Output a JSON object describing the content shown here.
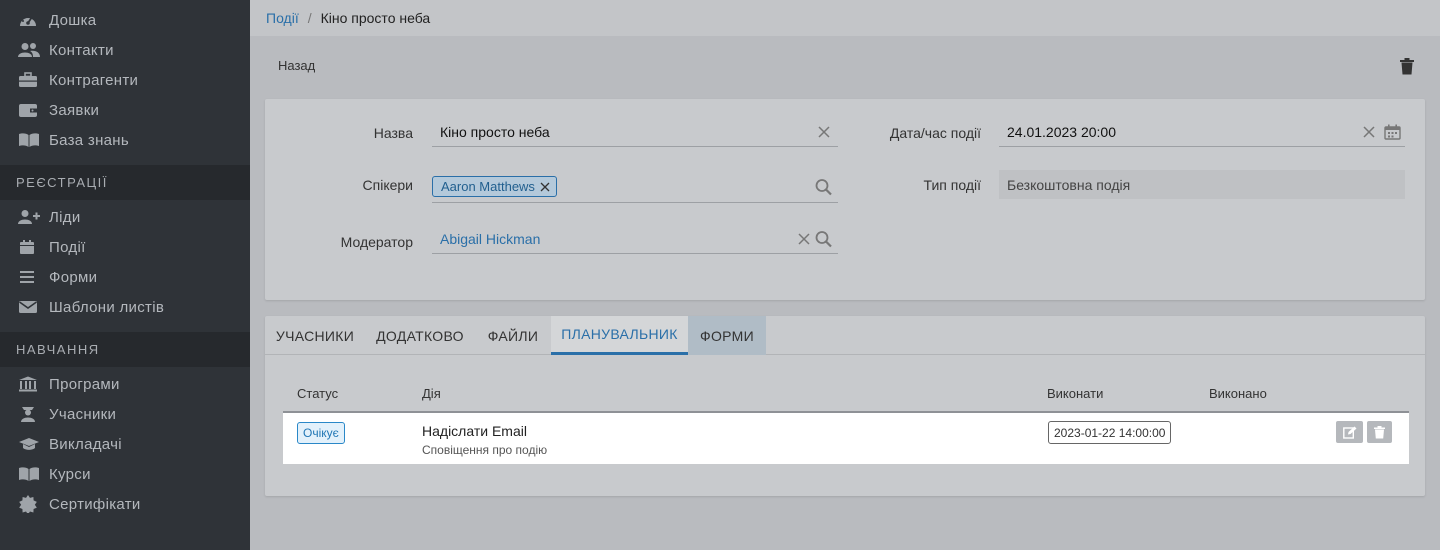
{
  "sidebar": {
    "items_top": [
      {
        "label": "Дошка",
        "icon": "dashboard-icon"
      },
      {
        "label": "Контакти",
        "icon": "users-icon"
      },
      {
        "label": "Контрагенти",
        "icon": "briefcase-icon"
      },
      {
        "label": "Заявки",
        "icon": "wallet-icon"
      },
      {
        "label": "База знань",
        "icon": "book-icon"
      }
    ],
    "section_registrations": "РЕЄСТРАЦІЇ",
    "items_reg": [
      {
        "label": "Ліди",
        "icon": "user-plus-icon"
      },
      {
        "label": "Події",
        "icon": "calendar-icon"
      },
      {
        "label": "Форми",
        "icon": "list-icon"
      },
      {
        "label": "Шаблони листів",
        "icon": "envelope-icon"
      }
    ],
    "section_learning": "НАВЧАННЯ",
    "items_learn": [
      {
        "label": "Програми",
        "icon": "bank-icon"
      },
      {
        "label": "Учасники",
        "icon": "student-icon"
      },
      {
        "label": "Викладачі",
        "icon": "graduation-cap-icon"
      },
      {
        "label": "Курси",
        "icon": "book-icon"
      },
      {
        "label": "Сертифікати",
        "icon": "certificate-icon"
      }
    ]
  },
  "breadcrumb": {
    "parent": "Події",
    "separator": "/",
    "current": "Кіно просто неба"
  },
  "toolbar": {
    "back_label": "Назад"
  },
  "form": {
    "name_label": "Назва",
    "name_value": "Кіно просто неба",
    "datetime_label": "Дата/час події",
    "datetime_value": "24.01.2023 20:00",
    "speakers_label": "Спікери",
    "speaker_chip": "Aaron Matthews",
    "event_type_label": "Тип події",
    "event_type_value": "Безкоштовна подія",
    "moderator_label": "Модератор",
    "moderator_value": "Abigail Hickman"
  },
  "tabs": [
    {
      "label": "УЧАСНИКИ"
    },
    {
      "label": "ДОДАТКОВО"
    },
    {
      "label": "ФАЙЛИ"
    },
    {
      "label": "ПЛАНУВАЛЬНИК"
    },
    {
      "label": "ФОРМИ"
    }
  ],
  "active_tab": "ПЛАНУВАЛЬНИК",
  "scheduler": {
    "columns": {
      "status": "Статус",
      "action": "Дія",
      "execute": "Виконати",
      "executed": "Виконано"
    },
    "rows": [
      {
        "status": "Очікує",
        "action": "Надіслати Email",
        "action_sub": "Сповіщення про подію",
        "execute": "2023-01-22 14:00:00",
        "executed": ""
      }
    ]
  },
  "colors": {
    "accent": "#2a6fa8",
    "sidebar_bg": "#2f3338",
    "section_bg": "#26292d"
  }
}
